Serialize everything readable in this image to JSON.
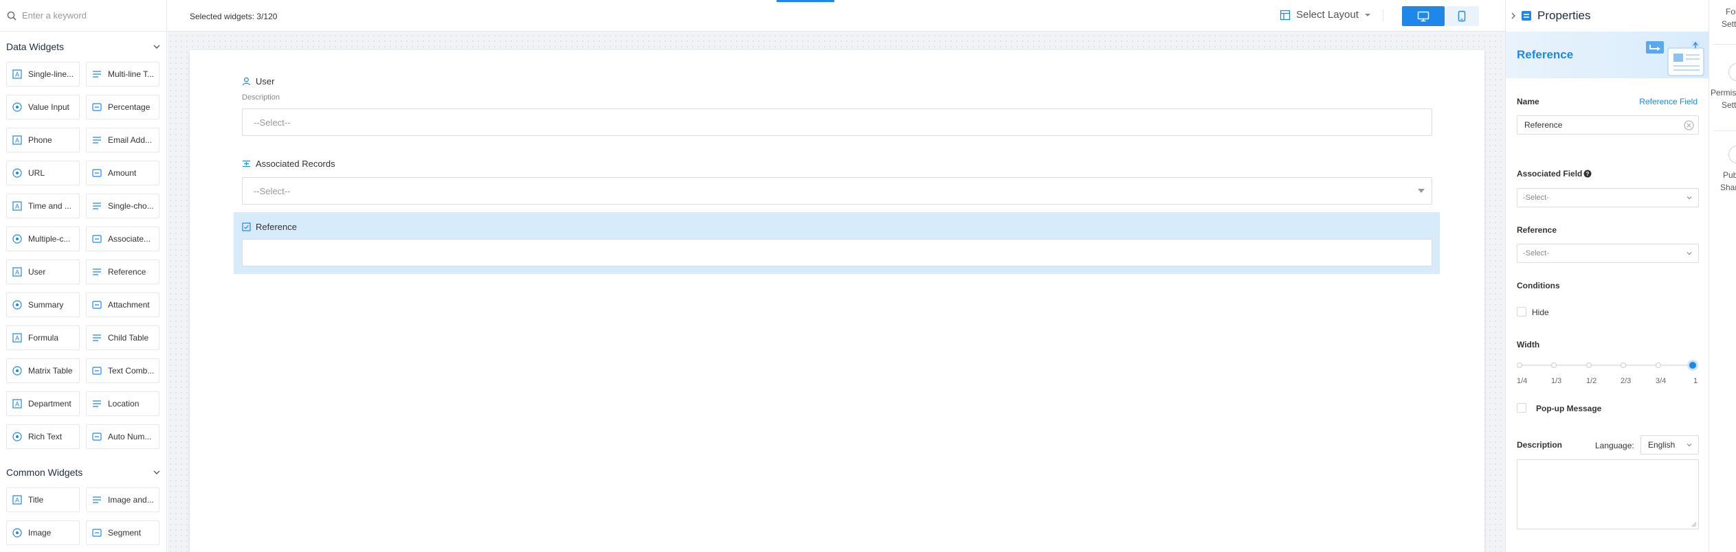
{
  "search": {
    "placeholder": "Enter a keyword"
  },
  "data_widgets": {
    "title": "Data Widgets",
    "items": [
      {
        "label": "Single-line...",
        "icon": "single-line-text-icon"
      },
      {
        "label": "Multi-line T...",
        "icon": "multi-line-text-icon"
      },
      {
        "label": "Value Input",
        "icon": "value-input-icon"
      },
      {
        "label": "Percentage",
        "icon": "percentage-icon"
      },
      {
        "label": "Phone",
        "icon": "phone-icon"
      },
      {
        "label": "Email Add...",
        "icon": "email-icon"
      },
      {
        "label": "URL",
        "icon": "link-icon"
      },
      {
        "label": "Amount",
        "icon": "amount-icon"
      },
      {
        "label": "Time and ...",
        "icon": "calendar-icon"
      },
      {
        "label": "Single-cho...",
        "icon": "single-choice-icon"
      },
      {
        "label": "Multiple-c...",
        "icon": "multiple-choice-icon"
      },
      {
        "label": "Associate...",
        "icon": "associated-records-icon"
      },
      {
        "label": "User",
        "icon": "user-icon"
      },
      {
        "label": "Reference",
        "icon": "reference-icon"
      },
      {
        "label": "Summary",
        "icon": "summary-icon"
      },
      {
        "label": "Attachment",
        "icon": "attachment-icon"
      },
      {
        "label": "Formula",
        "icon": "formula-icon"
      },
      {
        "label": "Child Table",
        "icon": "child-table-icon"
      },
      {
        "label": "Matrix Table",
        "icon": "matrix-table-icon"
      },
      {
        "label": "Text Comb...",
        "icon": "text-combination-icon"
      },
      {
        "label": "Department",
        "icon": "department-icon"
      },
      {
        "label": "Location",
        "icon": "location-icon"
      },
      {
        "label": "Rich Text",
        "icon": "rich-text-icon"
      },
      {
        "label": "Auto Num...",
        "icon": "auto-number-icon"
      }
    ]
  },
  "common_widgets": {
    "title": "Common Widgets",
    "items": [
      {
        "label": "Title",
        "icon": "title-icon"
      },
      {
        "label": "Image and...",
        "icon": "image-and-text-icon"
      },
      {
        "label": "Image",
        "icon": "image-icon"
      },
      {
        "label": "Segment",
        "icon": "segment-icon"
      }
    ]
  },
  "toolbar": {
    "selected": "Selected widgets: 3/120",
    "layout_label": "Select Layout",
    "accent": "#1f87e8"
  },
  "form": {
    "user": {
      "label": "User",
      "description": "Description",
      "placeholder": "--Select--"
    },
    "associated": {
      "label": "Associated Records",
      "placeholder": "--Select--"
    },
    "reference": {
      "label": "Reference",
      "value": ""
    }
  },
  "properties": {
    "title": "Properties",
    "banner_title": "Reference",
    "name_label": "Name",
    "name_type": "Reference Field",
    "name_value": "Reference",
    "associated_field_label": "Associated Field",
    "associated_field_placeholder": "-Select-",
    "reference_label": "Reference",
    "reference_placeholder": "-Select-",
    "conditions_label": "Conditions",
    "hide_label": "Hide",
    "width_label": "Width",
    "width_ticks": [
      "1/4",
      "1/3",
      "1/2",
      "2/3",
      "3/4",
      "1"
    ],
    "width_selected": "1",
    "popup_label": "Pop-up Message",
    "description_label": "Description",
    "language_label": "Language:",
    "language_value": "English",
    "description_value": ""
  },
  "strip": {
    "form_settings_1": "For",
    "form_settings_2": "Setti",
    "permissions_1": "Permis",
    "permissions_2": "Setti",
    "publish_1": "Pub",
    "publish_2": "Shar"
  }
}
